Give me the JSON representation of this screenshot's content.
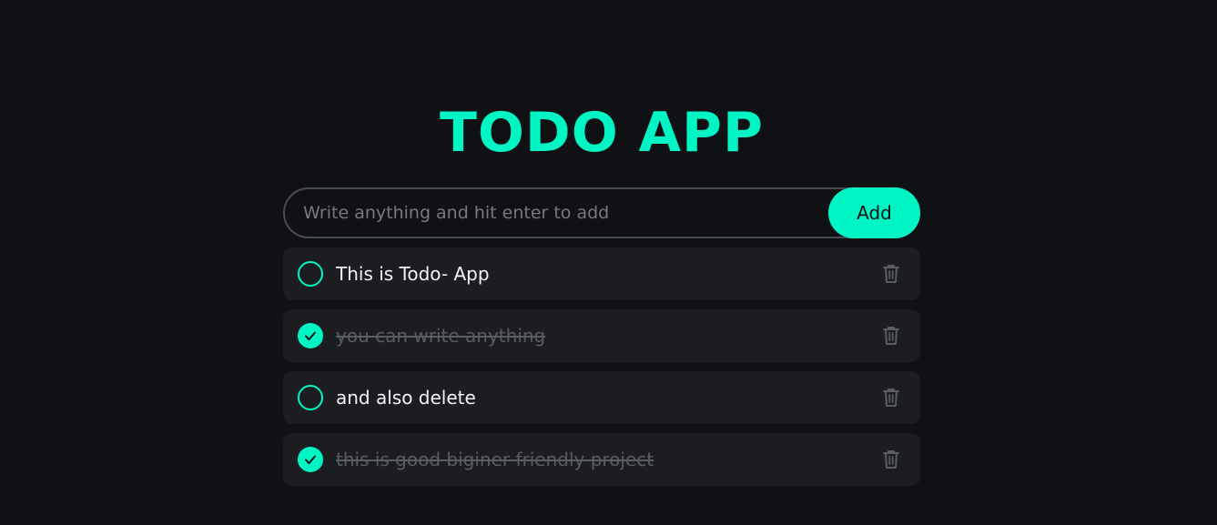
{
  "app": {
    "title": "TODO APP",
    "accent_color": "#00f5c4"
  },
  "input": {
    "placeholder": "Write anything and hit enter to add",
    "value": "",
    "add_label": "Add"
  },
  "todos": [
    {
      "text": "This is Todo- App",
      "completed": false,
      "check_icon": "circle-icon",
      "delete_icon": "trash-icon"
    },
    {
      "text": "you can write anything",
      "completed": true,
      "check_icon": "check-circle-icon",
      "delete_icon": "trash-icon"
    },
    {
      "text": "and also delete",
      "completed": false,
      "check_icon": "circle-icon",
      "delete_icon": "trash-icon"
    },
    {
      "text": "this is good biginer friendly project",
      "completed": true,
      "check_icon": "check-circle-icon",
      "delete_icon": "trash-icon"
    }
  ]
}
